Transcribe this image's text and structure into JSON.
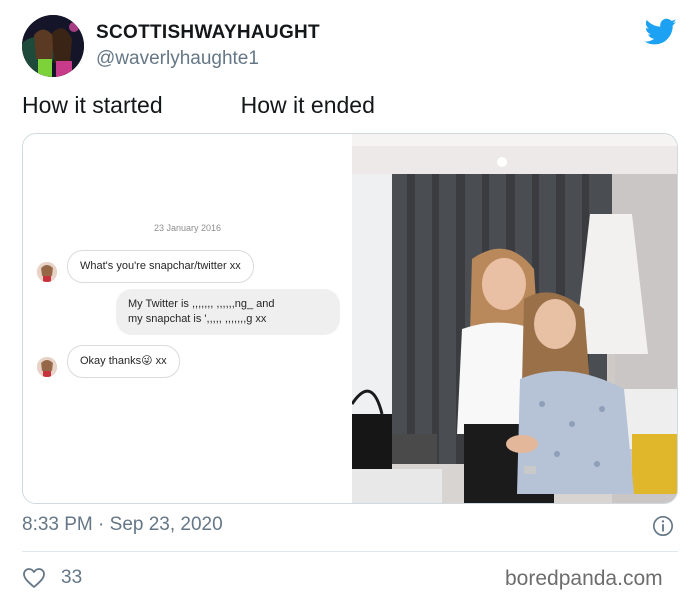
{
  "tweet": {
    "author": {
      "name": "SCOTTISHWAYHAUGHT",
      "handle": "@waverlyhaughte1"
    },
    "text_left": "How it started",
    "text_right": "How it ended",
    "media": {
      "chat": {
        "date": "23 January 2016",
        "messages": [
          {
            "direction": "incoming",
            "text": "What's you're snapchar/twitter xx"
          },
          {
            "direction": "outgoing",
            "line1": "My Twitter is ,,,,,,, ,,,,,,ng_ and",
            "line2": "my snapchat is ',,,,, ,,,,,,,g xx"
          },
          {
            "direction": "incoming",
            "text": "Okay thanks",
            "emoji": "😜",
            "suffix": "xx"
          }
        ]
      }
    },
    "timestamp": "8:33 PM · Sep 23, 2020",
    "likes": "33",
    "watermark": "boredpanda.com",
    "colors": {
      "twitter_blue": "#1da1f2",
      "secondary_text": "#657786",
      "border": "#cfd9de"
    },
    "icons": [
      "twitter-bird-icon",
      "info-icon",
      "heart-icon"
    ]
  }
}
